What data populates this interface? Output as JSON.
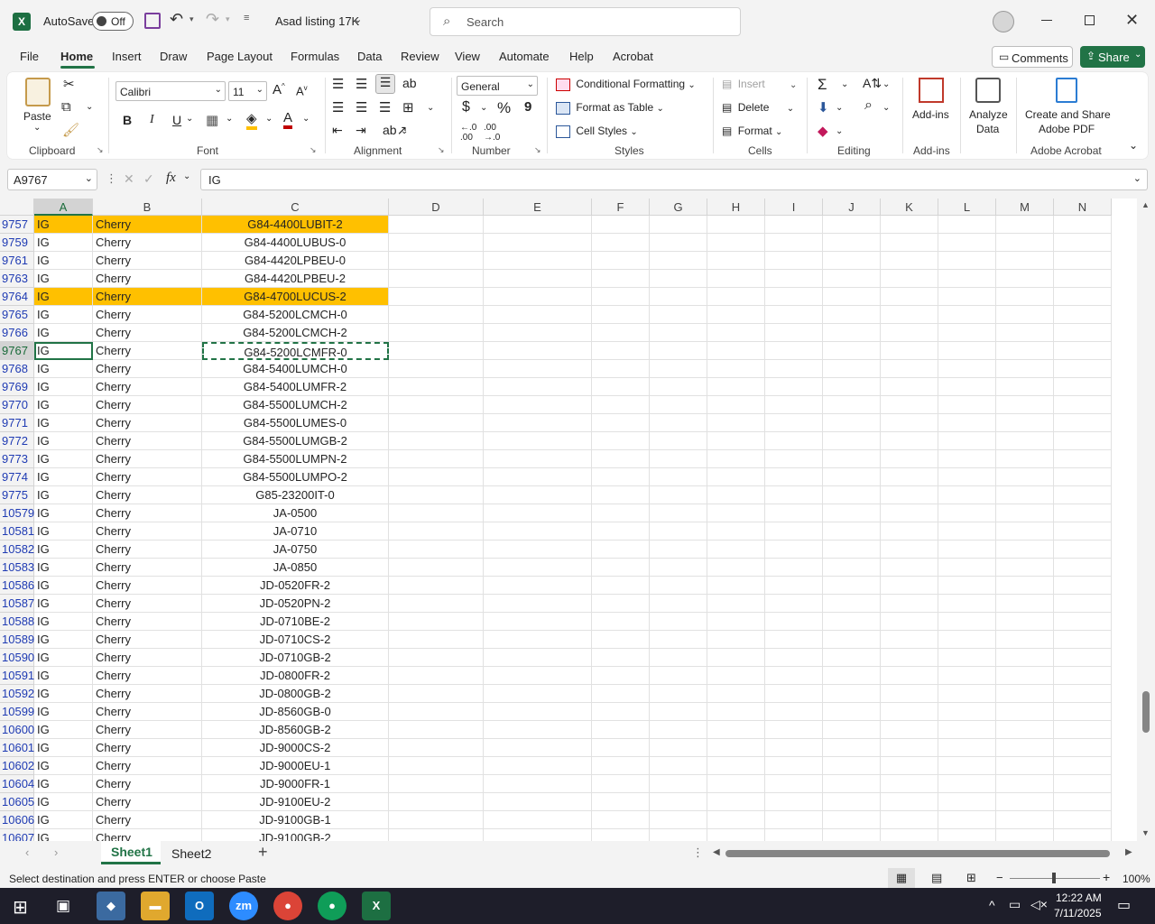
{
  "titlebar": {
    "autosave_label": "AutoSave",
    "autosave_state": "Off",
    "file_title": "Asad listing 17K",
    "search_placeholder": "Search"
  },
  "menu_tabs": [
    "File",
    "Home",
    "Insert",
    "Draw",
    "Page Layout",
    "Formulas",
    "Data",
    "Review",
    "View",
    "Automate",
    "Help",
    "Acrobat"
  ],
  "active_tab": "Home",
  "header_buttons": {
    "comments": "Comments",
    "share": "Share"
  },
  "ribbon": {
    "clipboard": {
      "paste": "Paste",
      "label": "Clipboard"
    },
    "font": {
      "name": "Calibri",
      "size": "11",
      "label": "Font",
      "bold": "B",
      "italic": "I",
      "underline": "U"
    },
    "alignment": {
      "label": "Alignment"
    },
    "number": {
      "format": "General",
      "label": "Number",
      "currency": "$",
      "percent": "%",
      "comma": "9"
    },
    "styles": {
      "conditional": "Conditional Formatting",
      "format_table": "Format as Table",
      "cell_styles": "Cell Styles",
      "label": "Styles"
    },
    "cells": {
      "insert": "Insert",
      "delete": "Delete",
      "format": "Format",
      "label": "Cells"
    },
    "editing": {
      "label": "Editing"
    },
    "addins": {
      "button": "Add-ins",
      "label": "Add-ins"
    },
    "analyze": {
      "line1": "Analyze",
      "line2": "Data"
    },
    "acrobat": {
      "line1": "Create and Share",
      "line2": "Adobe PDF",
      "label": "Adobe Acrobat"
    }
  },
  "formula_bar": {
    "name_box": "A9767",
    "fx": "fx",
    "value": "IG"
  },
  "columns": [
    "A",
    "B",
    "C",
    "D",
    "E",
    "F",
    "G",
    "H",
    "I",
    "J",
    "K",
    "L",
    "M",
    "N"
  ],
  "rows": [
    {
      "n": "9757",
      "a": "IG",
      "b": "Cherry",
      "c": "G84-4400LUBIT-2",
      "hl": true
    },
    {
      "n": "9759",
      "a": "IG",
      "b": "Cherry",
      "c": "G84-4400LUBUS-0",
      "hl": false
    },
    {
      "n": "9761",
      "a": "IG",
      "b": "Cherry",
      "c": "G84-4420LPBEU-0",
      "hl": false
    },
    {
      "n": "9763",
      "a": "IG",
      "b": "Cherry",
      "c": "G84-4420LPBEU-2",
      "hl": false
    },
    {
      "n": "9764",
      "a": "IG",
      "b": "Cherry",
      "c": "G84-4700LUCUS-2",
      "hl": true
    },
    {
      "n": "9765",
      "a": "IG",
      "b": "Cherry",
      "c": "G84-5200LCMCH-0",
      "hl": false
    },
    {
      "n": "9766",
      "a": "IG",
      "b": "Cherry",
      "c": "G84-5200LCMCH-2",
      "hl": false
    },
    {
      "n": "9767",
      "a": "IG",
      "b": "Cherry",
      "c": "G84-5200LCMFR-0",
      "hl": false
    },
    {
      "n": "9768",
      "a": "IG",
      "b": "Cherry",
      "c": "G84-5400LUMCH-0",
      "hl": false
    },
    {
      "n": "9769",
      "a": "IG",
      "b": "Cherry",
      "c": "G84-5400LUMFR-2",
      "hl": false
    },
    {
      "n": "9770",
      "a": "IG",
      "b": "Cherry",
      "c": "G84-5500LUMCH-2",
      "hl": false
    },
    {
      "n": "9771",
      "a": "IG",
      "b": "Cherry",
      "c": "G84-5500LUMES-0",
      "hl": false
    },
    {
      "n": "9772",
      "a": "IG",
      "b": "Cherry",
      "c": "G84-5500LUMGB-2",
      "hl": false
    },
    {
      "n": "9773",
      "a": "IG",
      "b": "Cherry",
      "c": "G84-5500LUMPN-2",
      "hl": false
    },
    {
      "n": "9774",
      "a": "IG",
      "b": "Cherry",
      "c": "G84-5500LUMPO-2",
      "hl": false
    },
    {
      "n": "9775",
      "a": "IG",
      "b": "Cherry",
      "c": "G85-23200IT-0",
      "hl": false
    },
    {
      "n": "10579",
      "a": "IG",
      "b": "Cherry",
      "c": "JA-0500",
      "hl": false
    },
    {
      "n": "10581",
      "a": "IG",
      "b": "Cherry",
      "c": "JA-0710",
      "hl": false
    },
    {
      "n": "10582",
      "a": "IG",
      "b": "Cherry",
      "c": "JA-0750",
      "hl": false
    },
    {
      "n": "10583",
      "a": "IG",
      "b": "Cherry",
      "c": "JA-0850",
      "hl": false
    },
    {
      "n": "10586",
      "a": "IG",
      "b": "Cherry",
      "c": "JD-0520FR-2",
      "hl": false
    },
    {
      "n": "10587",
      "a": "IG",
      "b": "Cherry",
      "c": "JD-0520PN-2",
      "hl": false
    },
    {
      "n": "10588",
      "a": "IG",
      "b": "Cherry",
      "c": "JD-0710BE-2",
      "hl": false
    },
    {
      "n": "10589",
      "a": "IG",
      "b": "Cherry",
      "c": "JD-0710CS-2",
      "hl": false
    },
    {
      "n": "10590",
      "a": "IG",
      "b": "Cherry",
      "c": "JD-0710GB-2",
      "hl": false
    },
    {
      "n": "10591",
      "a": "IG",
      "b": "Cherry",
      "c": "JD-0800FR-2",
      "hl": false
    },
    {
      "n": "10592",
      "a": "IG",
      "b": "Cherry",
      "c": "JD-0800GB-2",
      "hl": false
    },
    {
      "n": "10599",
      "a": "IG",
      "b": "Cherry",
      "c": "JD-8560GB-0",
      "hl": false
    },
    {
      "n": "10600",
      "a": "IG",
      "b": "Cherry",
      "c": "JD-8560GB-2",
      "hl": false
    },
    {
      "n": "10601",
      "a": "IG",
      "b": "Cherry",
      "c": "JD-9000CS-2",
      "hl": false
    },
    {
      "n": "10602",
      "a": "IG",
      "b": "Cherry",
      "c": "JD-9000EU-1",
      "hl": false
    },
    {
      "n": "10604",
      "a": "IG",
      "b": "Cherry",
      "c": "JD-9000FR-1",
      "hl": false
    },
    {
      "n": "10605",
      "a": "IG",
      "b": "Cherry",
      "c": "JD-9100EU-2",
      "hl": false
    },
    {
      "n": "10606",
      "a": "IG",
      "b": "Cherry",
      "c": "JD-9100GB-1",
      "hl": false
    },
    {
      "n": "10607",
      "a": "IG",
      "b": "Cherry",
      "c": "JD-9100GB-2",
      "hl": false
    }
  ],
  "selected_row": "9767",
  "selected_col": "A",
  "sheets": [
    "Sheet1",
    "Sheet2"
  ],
  "active_sheet": "Sheet1",
  "status": {
    "message": "Select destination and press ENTER or choose Paste",
    "zoom": "100%"
  },
  "taskbar": {
    "time": "12:22 AM",
    "date": "7/11/2025"
  },
  "colors": {
    "highlight": "#ffc000",
    "excel_green": "#217346",
    "row_number": "#1f3bb3"
  }
}
